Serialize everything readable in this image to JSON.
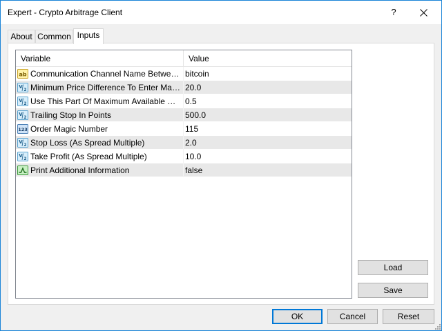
{
  "window": {
    "title": "Expert - Crypto Arbitrage Client",
    "help_label": "?"
  },
  "tabs": [
    {
      "label": "About",
      "active": false
    },
    {
      "label": "Common",
      "active": false
    },
    {
      "label": "Inputs",
      "active": true
    }
  ],
  "grid": {
    "columns": [
      "Variable",
      "Value"
    ],
    "rows": [
      {
        "icon": "ab-string-icon",
        "variable": "Communication Channel Name Between Clients",
        "value": "bitcoin"
      },
      {
        "icon": "double-value-icon",
        "variable": "Minimum Price Difference To Enter Market",
        "value": "20.0"
      },
      {
        "icon": "double-value-icon",
        "variable": "Use This Part Of Maximum Available Risk",
        "value": "0.5"
      },
      {
        "icon": "double-value-icon",
        "variable": "Trailing Stop In Points",
        "value": "500.0"
      },
      {
        "icon": "integer-123-icon",
        "variable": "Order Magic Number",
        "value": "115"
      },
      {
        "icon": "double-value-icon",
        "variable": "Stop Loss (As Spread Multiple)",
        "value": "2.0"
      },
      {
        "icon": "double-value-icon",
        "variable": "Take Profit (As Spread Multiple)",
        "value": "10.0"
      },
      {
        "icon": "boolean-icon",
        "variable": "Print Additional Information",
        "value": "false"
      }
    ]
  },
  "side_buttons": {
    "load": "Load",
    "save": "Save"
  },
  "footer_buttons": {
    "ok": "OK",
    "cancel": "Cancel",
    "reset": "Reset"
  },
  "colors": {
    "window_border": "#1883d7",
    "default_button_border": "#0078d7",
    "alt_row": "#e8e8e8"
  }
}
